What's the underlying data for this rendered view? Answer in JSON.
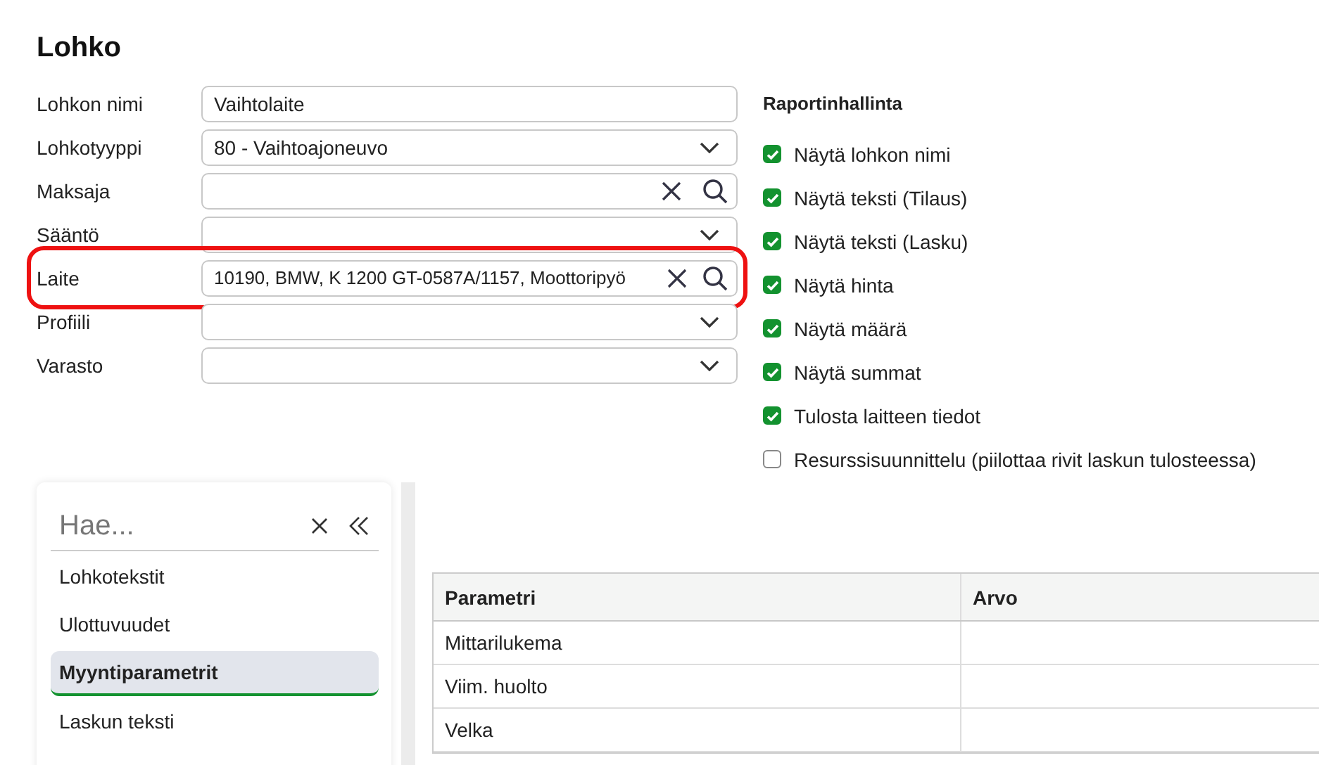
{
  "title": "Lohko",
  "fields": [
    {
      "label": "Lohkon nimi",
      "kind": "text",
      "value": "Vaihtolaite",
      "highlighted": false
    },
    {
      "label": "Lohkotyyppi",
      "kind": "select",
      "value": "80 - Vaihtoajoneuvo",
      "highlighted": false
    },
    {
      "label": "Maksaja",
      "kind": "lookup",
      "highlighted": false
    },
    {
      "label": "Sääntö",
      "kind": "select",
      "highlighted": false
    },
    {
      "label": "Laite",
      "kind": "lookup",
      "value": "10190, BMW, K 1200 GT-0587A/1157, Moottoripyö",
      "highlighted": true
    },
    {
      "label": "Profiili",
      "kind": "select",
      "highlighted": false
    },
    {
      "label": "Varasto",
      "kind": "select",
      "highlighted": false
    }
  ],
  "report": {
    "title": "Raportinhallinta",
    "options": [
      {
        "label": "Näytä lohkon nimi",
        "checked": true
      },
      {
        "label": "Näytä teksti (Tilaus)",
        "checked": true
      },
      {
        "label": "Näytä teksti (Lasku)",
        "checked": true
      },
      {
        "label": "Näytä hinta",
        "checked": true
      },
      {
        "label": "Näytä määrä",
        "checked": true
      },
      {
        "label": "Näytä summat",
        "checked": true
      },
      {
        "label": "Tulosta laitteen tiedot",
        "checked": true
      },
      {
        "label": "Resurssisuunnittelu (piilottaa rivit laskun tulosteessa)",
        "checked": false
      }
    ]
  },
  "sidebar": {
    "search": {
      "placeholder": "Hae..."
    },
    "items": [
      {
        "label": "Lohkotekstit",
        "selected": false
      },
      {
        "label": "Ulottuvuudet",
        "selected": false
      },
      {
        "label": "Myyntiparametrit",
        "selected": true
      },
      {
        "label": "Laskun teksti",
        "selected": false
      }
    ]
  },
  "table": {
    "columns": [
      "Parametri",
      "Arvo"
    ],
    "rows": [
      [
        "Mittarilukema",
        ""
      ],
      [
        "Viim. huolto",
        ""
      ],
      [
        "Velka",
        ""
      ]
    ]
  }
}
